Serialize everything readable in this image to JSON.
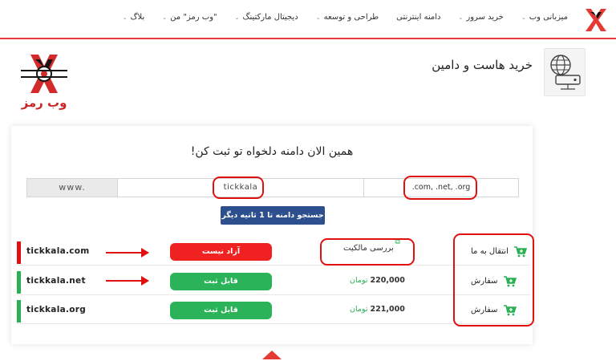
{
  "nav": {
    "items": [
      {
        "label": "میزبانی وب",
        "has_caret": true
      },
      {
        "label": "خرید سرور",
        "has_caret": true
      },
      {
        "label": "دامنه اینترنتی",
        "has_caret": false
      },
      {
        "label": "طراحی و توسعه",
        "has_caret": true
      },
      {
        "label": "دیجیتال مارکتینگ",
        "has_caret": true
      },
      {
        "label": "\"وب رمز\" من",
        "has_caret": true
      },
      {
        "label": "بلاگ",
        "has_caret": true
      }
    ],
    "caret": "⌄"
  },
  "header": {
    "title": "خرید هاست و دامین",
    "icon": "globe-server-icon"
  },
  "brand": {
    "name": "وب رمز",
    "accent": "#e53935"
  },
  "search": {
    "heading": "همین الان دامنه دلخواه تو ثبت کن!",
    "prefix": "www.",
    "domain_value": "tickkala",
    "extensions": ".com, .net, .org",
    "button_label": "جستجو دامنه تا 1 ثانیه دیگر"
  },
  "results": [
    {
      "domain": "tickkala.com",
      "available": false,
      "status_label": "آزاد نیست",
      "check_label": "بررسی مالکیت",
      "price": "",
      "currency": "",
      "action_label": "انتقال به ما",
      "bar_color": "#e01010",
      "status_color": "#f02121"
    },
    {
      "domain": "tickkala.net",
      "available": true,
      "status_label": "قابل ثبت",
      "check_label": "",
      "price": "220,000",
      "currency": "تومان",
      "action_label": "سفارش",
      "bar_color": "#2bb056",
      "status_color": "#2bb35a"
    },
    {
      "domain": "tickkala.org",
      "available": true,
      "status_label": "قابل ثبت",
      "check_label": "",
      "price": "221,000",
      "currency": "تومان",
      "action_label": "سفارش",
      "bar_color": "#2bb056",
      "status_color": "#2bb35a"
    }
  ]
}
